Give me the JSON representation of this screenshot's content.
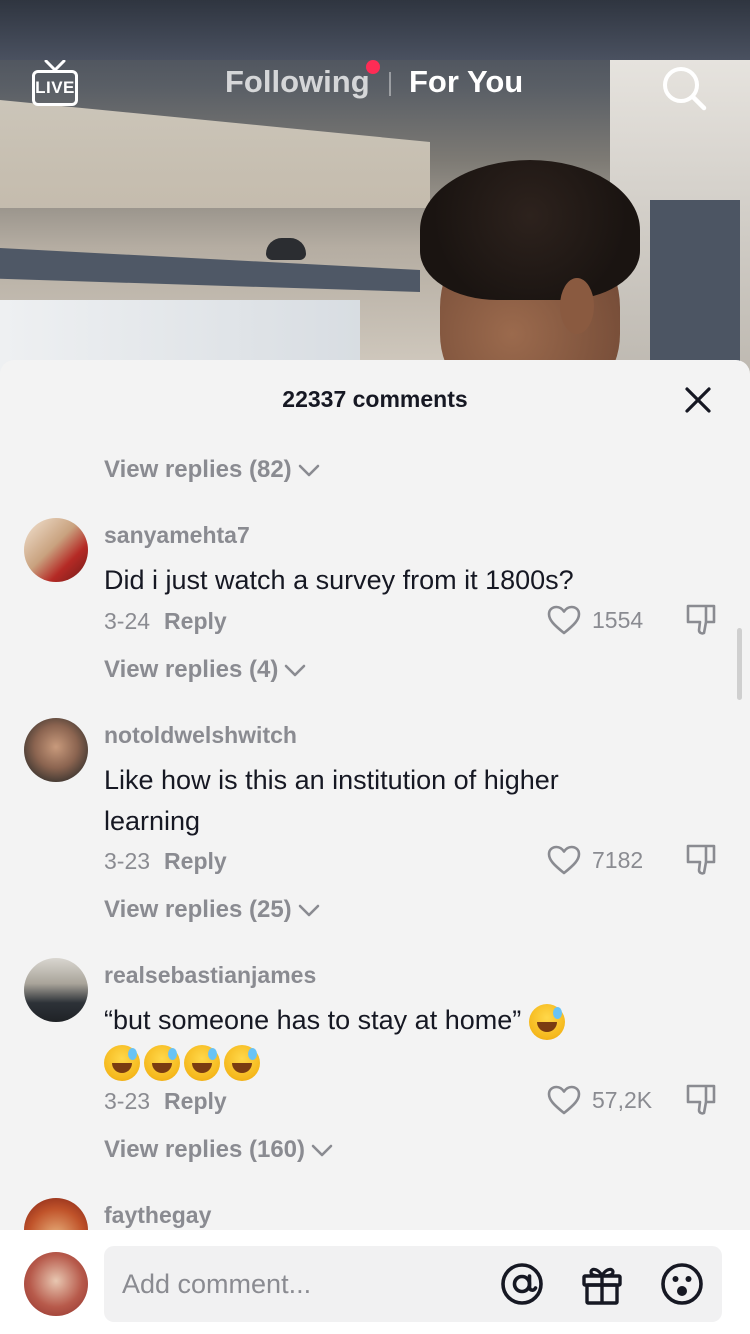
{
  "top_nav": {
    "live_label": "LIVE",
    "tabs": [
      {
        "label": "Following",
        "has_notification_dot": true
      },
      {
        "label": "For You",
        "active": true
      }
    ]
  },
  "comments_sheet": {
    "title": "22337 comments",
    "view_replies_top": "View replies (82)",
    "comments": [
      {
        "username": "sanyamehta7",
        "text": "Did i just watch a survey from it 1800s?",
        "date": "3-24",
        "reply_label": "Reply",
        "likes": "1554",
        "view_replies": "View replies (4)"
      },
      {
        "username": "notoldwelshwitch",
        "text": "Like how is this an institution of higher learning",
        "date": "3-23",
        "reply_label": "Reply",
        "likes": "7182",
        "view_replies": "View replies (25)"
      },
      {
        "username": "realsebastianjames",
        "text": "“but someone has to stay at home”",
        "date": "3-23",
        "reply_label": "Reply",
        "likes": "57,2K",
        "view_replies": "View replies (160)"
      },
      {
        "username": "faythegay"
      }
    ]
  },
  "bottom_bar": {
    "placeholder": "Add comment..."
  },
  "colors": {
    "notification_dot": "#fe2c55",
    "sheet_bg": "#f3f3f3",
    "muted_text": "#8a8b91",
    "primary_text": "#161823"
  }
}
